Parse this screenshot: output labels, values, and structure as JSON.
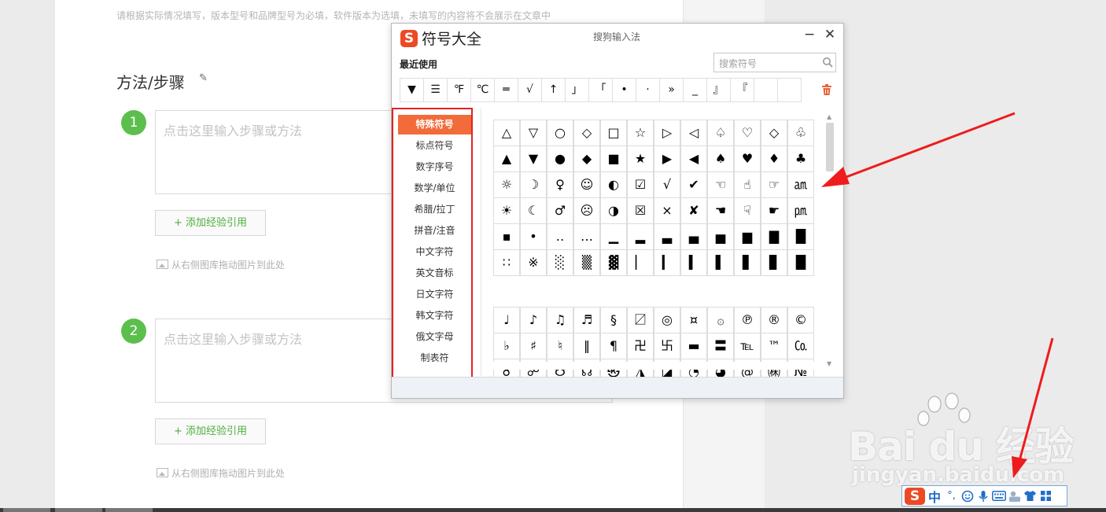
{
  "page": {
    "hint": "请根据实际情况填写，版本型号和品牌型号为必填，软件版本为选填，未填写的内容将不会展示在文章中",
    "section_title": "方法/步骤",
    "steps": [
      {
        "number": "1",
        "placeholder": "点击这里输入步骤或方法",
        "cite_button": "+ 添加经验引用",
        "drag_hint": "从右侧图库拖动图片到此处"
      },
      {
        "number": "2",
        "placeholder": "点击这里输入步骤或方法",
        "cite_button": "+ 添加经验引用",
        "drag_hint": "从右侧图库拖动图片到此处"
      }
    ]
  },
  "dialog": {
    "logo": "S",
    "title": "符号大全",
    "app_name": "搜狗输入法",
    "minimize": "−",
    "close": "✕",
    "recent_label": "最近使用",
    "search_placeholder": "搜索符号",
    "recent": [
      "▼",
      "☰",
      "℉",
      "℃",
      "═",
      "√",
      "↑",
      "」",
      "「",
      "•",
      "·",
      "»",
      "_",
      "』",
      "『",
      "",
      ""
    ],
    "categories": [
      "特殊符号",
      "标点符号",
      "数字序号",
      "数学/单位",
      "希腊/拉丁",
      "拼音/注音",
      "中文字符",
      "英文音标",
      "日文字符",
      "韩文字符",
      "俄文字母",
      "制表符"
    ],
    "active_category": "特殊符号",
    "grid_a": [
      [
        "△",
        "▽",
        "○",
        "◇",
        "□",
        "☆",
        "▷",
        "◁",
        "♤",
        "♡",
        "◇",
        "♧"
      ],
      [
        "▲",
        "▼",
        "●",
        "◆",
        "■",
        "★",
        "▶",
        "◀",
        "♠",
        "♥",
        "♦",
        "♣"
      ],
      [
        "☼",
        "☽",
        "♀",
        "☺",
        "◐",
        "☑",
        "√",
        "✔",
        "☜",
        "☝",
        "☞",
        "㏂"
      ],
      [
        "☀",
        "☾",
        "♂",
        "☹",
        "◑",
        "☒",
        "×",
        "✘",
        "☚",
        "☟",
        "☛",
        "㏘"
      ],
      [
        "▪",
        "•",
        "‥",
        "…",
        "▁",
        "▂",
        "▃",
        "▄",
        "▅",
        "▆",
        "▇",
        "█"
      ],
      [
        "∷",
        "※",
        "░",
        "▒",
        "▓",
        "▏",
        "▎",
        "▍",
        "▌",
        "▋",
        "▊",
        "█"
      ]
    ],
    "grid_b": [
      [
        "♩",
        "♪",
        "♫",
        "♬",
        "§",
        "〼",
        "◎",
        "¤",
        "۞",
        "℗",
        "®",
        "©"
      ],
      [
        "♭",
        "♯",
        "♮",
        "‖",
        "¶",
        "卍",
        "卐",
        "▬",
        "〓",
        "℡",
        "™",
        "㏇"
      ],
      [
        "☌",
        "☍",
        "☋",
        "☊",
        "㉿",
        "◮",
        "◪",
        "◔",
        "◕",
        "@",
        "㈱",
        "№"
      ]
    ]
  },
  "watermark": {
    "brand": "Bai du 经验",
    "url": "jingyan.baidu.com"
  },
  "imebar": {
    "logo": "S",
    "mode": "中",
    "punct": "°,",
    "icons": [
      "smiley-icon",
      "microphone-icon",
      "keyboard-icon",
      "toolbox-icon",
      "shirt-icon",
      "grid-icon"
    ]
  },
  "colors": {
    "sogou_orange": "#ec4a24",
    "active_category": "#f26b3a",
    "highlight_red": "#e42222",
    "step_green": "#5cbf4d"
  }
}
